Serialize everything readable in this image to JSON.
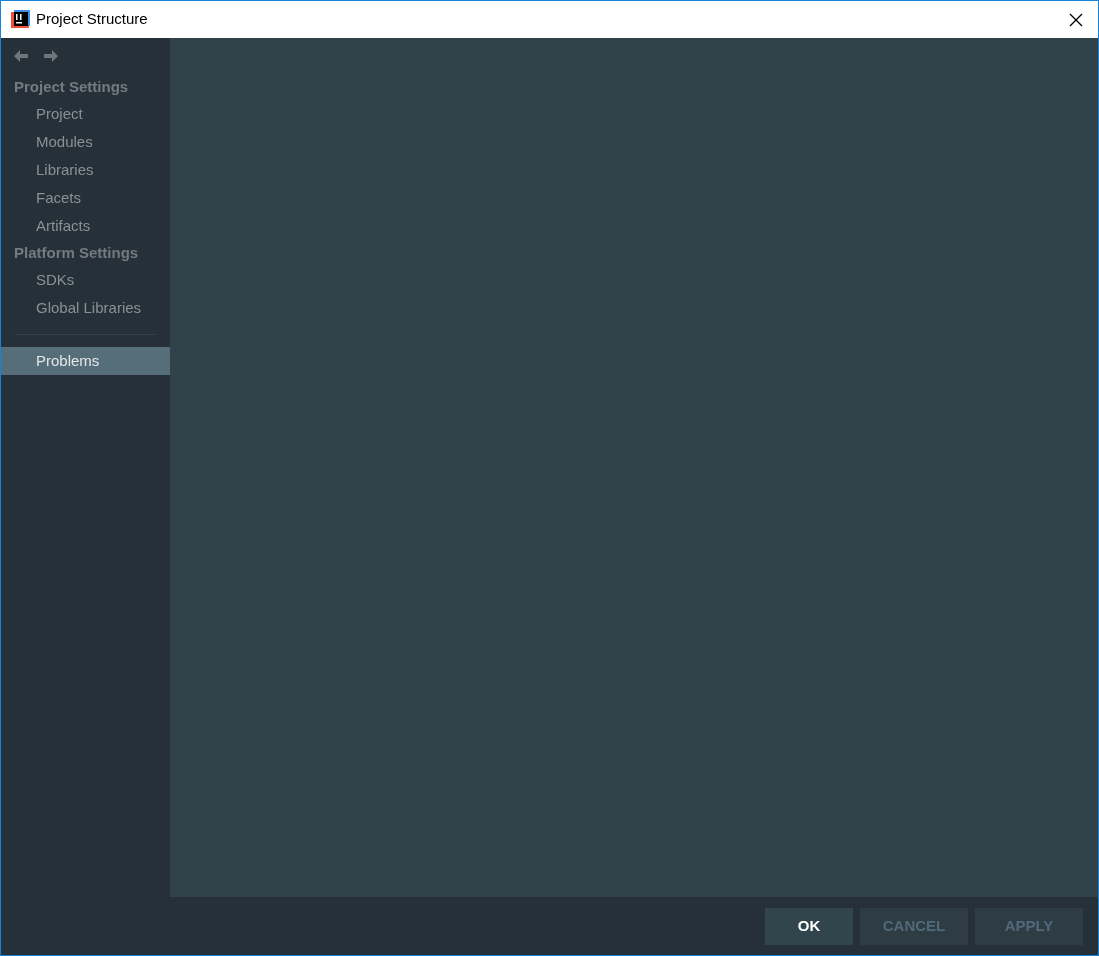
{
  "window": {
    "title": "Project Structure"
  },
  "sidebar": {
    "sections": [
      {
        "title": "Project Settings",
        "items": [
          {
            "label": "Project",
            "selected": false
          },
          {
            "label": "Modules",
            "selected": false
          },
          {
            "label": "Libraries",
            "selected": false
          },
          {
            "label": "Facets",
            "selected": false
          },
          {
            "label": "Artifacts",
            "selected": false
          }
        ]
      },
      {
        "title": "Platform Settings",
        "items": [
          {
            "label": "SDKs",
            "selected": false
          },
          {
            "label": "Global Libraries",
            "selected": false
          }
        ]
      }
    ],
    "bottom_items": [
      {
        "label": "Problems",
        "selected": true
      }
    ]
  },
  "buttons": [
    {
      "label": "OK",
      "disabled": false
    },
    {
      "label": "CANCEL",
      "disabled": true
    },
    {
      "label": "APPLY",
      "disabled": true
    }
  ]
}
